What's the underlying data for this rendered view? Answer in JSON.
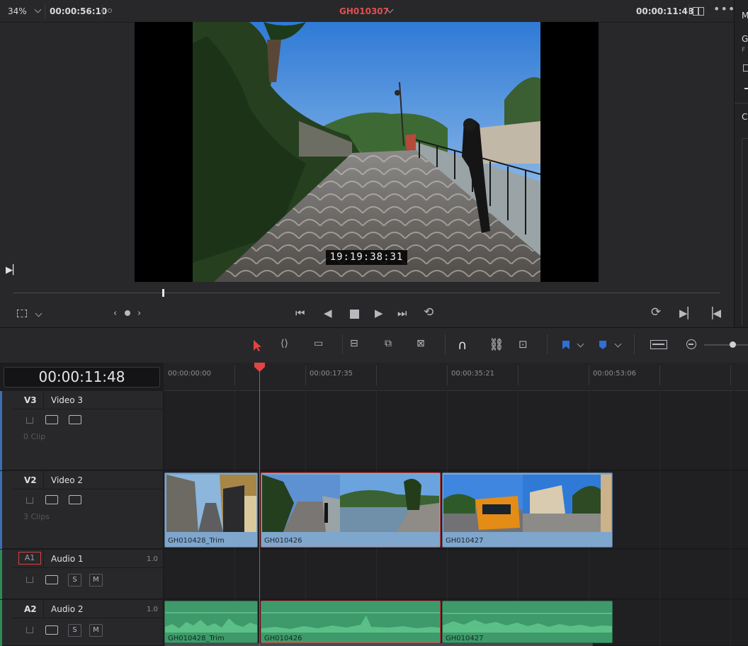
{
  "viewer": {
    "zoom": "34%",
    "source_timecode": "00:00:56:10",
    "clip_name": "GH010307",
    "record_timecode": "00:00:11:48",
    "burnin_timecode": "19:19:38:31",
    "scrub_position": 0.212
  },
  "timeline": {
    "timecode": "00:00:11:48",
    "ruler": [
      "00:00:00:00",
      "00:00:17:35",
      "00:00:35:21",
      "00:00:53:06"
    ],
    "tracks": {
      "v3": {
        "id": "V3",
        "name": "Video 3",
        "clip_count": "0 Clip"
      },
      "v2": {
        "id": "V2",
        "name": "Video 2",
        "clip_count": "3 Clips"
      },
      "a1": {
        "id": "A1",
        "name": "Audio 1",
        "volume": "1.0",
        "solo": "S",
        "mute": "M"
      },
      "a2": {
        "id": "A2",
        "name": "Audio 2",
        "volume": "1.0",
        "solo": "S",
        "mute": "M"
      }
    },
    "video_clips": [
      "GH010428_Trim",
      "GH010426",
      "GH010427"
    ],
    "audio_clips": [
      "GH010428_Trim",
      "GH010426",
      "GH010427"
    ]
  },
  "right_panel": {
    "labels": [
      "M",
      "G",
      "F",
      "C"
    ]
  },
  "colors": {
    "accent_red": "#d84040",
    "video_clip": "#7fa6cc",
    "audio_clip": "#3e9a6a",
    "flag_blue": "#2f6fd6"
  }
}
